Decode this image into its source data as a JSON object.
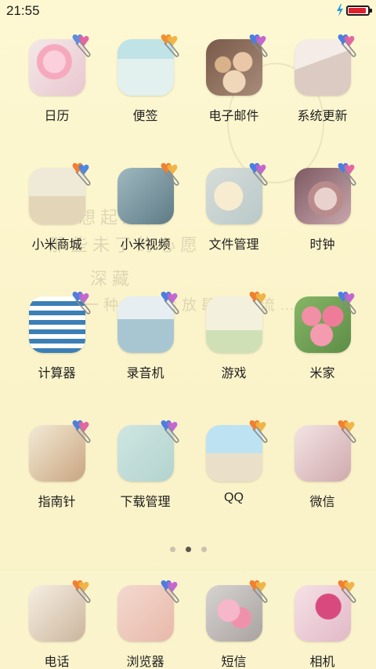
{
  "status_bar": {
    "time": "21:55",
    "battery_level": 0.92,
    "charging": true,
    "battery_color": "#e0202a"
  },
  "wallpaper_text": [
    "想起过往",
    "那些未了的心愿",
    "深藏",
    "那一种像感会放肆地在流…"
  ],
  "apps": [
    {
      "label": "日历",
      "icon": "calendar-icon"
    },
    {
      "label": "便签",
      "icon": "notes-icon"
    },
    {
      "label": "电子邮件",
      "icon": "email-icon"
    },
    {
      "label": "系统更新",
      "icon": "system-update-icon"
    },
    {
      "label": "小米商城",
      "icon": "mi-store-icon"
    },
    {
      "label": "小米视频",
      "icon": "mi-video-icon"
    },
    {
      "label": "文件管理",
      "icon": "file-manager-icon"
    },
    {
      "label": "时钟",
      "icon": "clock-icon"
    },
    {
      "label": "计算器",
      "icon": "calculator-icon"
    },
    {
      "label": "录音机",
      "icon": "recorder-icon"
    },
    {
      "label": "游戏",
      "icon": "games-icon"
    },
    {
      "label": "米家",
      "icon": "mijia-icon"
    },
    {
      "label": "指南针",
      "icon": "compass-icon"
    },
    {
      "label": "下载管理",
      "icon": "downloads-icon"
    },
    {
      "label": "QQ",
      "icon": "qq-icon"
    },
    {
      "label": "微信",
      "icon": "wechat-icon"
    }
  ],
  "dock": [
    {
      "label": "电话",
      "icon": "phone-icon"
    },
    {
      "label": "浏览器",
      "icon": "browser-icon"
    },
    {
      "label": "短信",
      "icon": "messages-icon"
    },
    {
      "label": "相机",
      "icon": "camera-icon"
    }
  ],
  "pages": {
    "count": 3,
    "current": 2
  }
}
